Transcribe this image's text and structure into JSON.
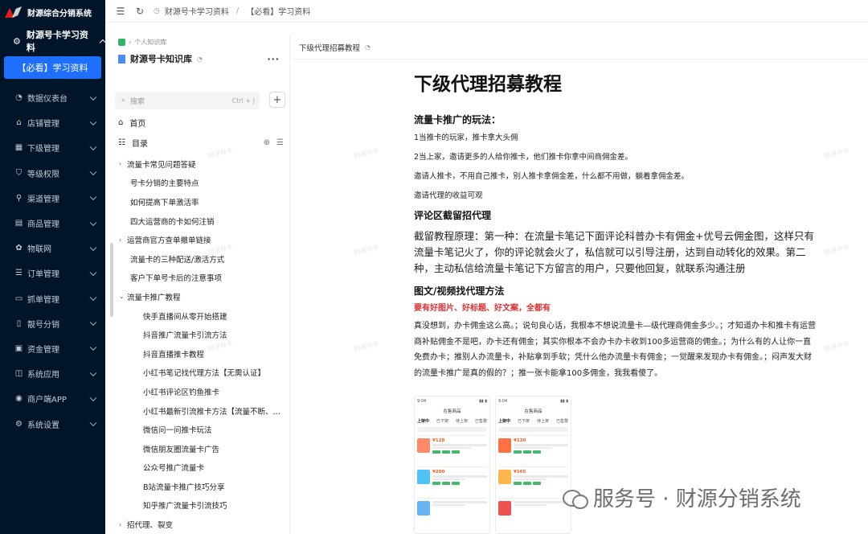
{
  "brand": {
    "title": "财源综合分销系统"
  },
  "header": {
    "breadcrumb": [
      "财源号卡学习资料",
      "【必看】学习资料"
    ]
  },
  "nav": {
    "group_title": "财源号卡学习资料",
    "active_item": "【必看】学习资料",
    "items": [
      {
        "label": "数据仪表台",
        "icon": "dashboard-icon"
      },
      {
        "label": "店铺管理",
        "icon": "shop-icon"
      },
      {
        "label": "下级管理",
        "icon": "grid-icon"
      },
      {
        "label": "等级权限",
        "icon": "shield-icon"
      },
      {
        "label": "渠道管理",
        "icon": "channel-icon"
      },
      {
        "label": "商品管理",
        "icon": "goods-icon"
      },
      {
        "label": "物联网",
        "icon": "iot-icon"
      },
      {
        "label": "订单管理",
        "icon": "order-icon"
      },
      {
        "label": "抓单管理",
        "icon": "catch-order-icon"
      },
      {
        "label": "靓号分销",
        "icon": "phone-icon"
      },
      {
        "label": "资金管理",
        "icon": "fund-icon"
      },
      {
        "label": "系统应用",
        "icon": "app-icon"
      },
      {
        "label": "商户端APP",
        "icon": "merchant-app-icon"
      },
      {
        "label": "系统设置",
        "icon": "gear-icon"
      }
    ]
  },
  "kb": {
    "path": "个人知识库",
    "title": "财源号卡知识库",
    "more": "···",
    "search_placeholder": "搜索",
    "search_shortcut": "Ctrl + J",
    "home": "首页",
    "toc": "目录",
    "tree": [
      {
        "label": "流量卡常见问题答疑",
        "level": 0,
        "caret": "›"
      },
      {
        "label": "号卡分销的主要特点",
        "level": 1
      },
      {
        "label": "如何提高下单激活率",
        "level": 1
      },
      {
        "label": "四大运营商的卡如何注销",
        "level": 1
      },
      {
        "label": "运营商官方查单撤单链接",
        "level": 0,
        "caret": "›"
      },
      {
        "label": "流量卡的三种配送/激活方式",
        "level": 1
      },
      {
        "label": "客户下单号卡后的注意事项",
        "level": 1
      },
      {
        "label": "流量卡推广教程",
        "level": 0,
        "caret": "⌄"
      },
      {
        "label": "快手直播间从零开始搭建",
        "level": 2
      },
      {
        "label": "抖音推广流量卡引流方法",
        "level": 2
      },
      {
        "label": "抖音直播推卡教程",
        "level": 2
      },
      {
        "label": "小红书笔记找代理方法【无需认证】",
        "level": 2
      },
      {
        "label": "小红书评论区钓鱼推卡",
        "level": 2
      },
      {
        "label": "小红书最新引流推卡方法【流量不断、…",
        "level": 2
      },
      {
        "label": "微信问一问推卡玩法",
        "level": 2
      },
      {
        "label": "微信朋友圈流量卡广告",
        "level": 2
      },
      {
        "label": "公众号推广流量卡",
        "level": 2
      },
      {
        "label": "B站流量卡推广技巧分享",
        "level": 2
      },
      {
        "label": "知乎推广流量卡引流技巧",
        "level": 2
      },
      {
        "label": "招代理、裂变",
        "level": 0,
        "caret": "›"
      }
    ]
  },
  "doc": {
    "head": "下级代理招募教程",
    "title": "下级代理招募教程",
    "s1_title": "流量卡推广的玩法：",
    "s1_p1": "1当推卡的玩家，推卡拿大头佣",
    "s1_p2": "2当上家，邀请更多的人给你推卡，他们推卡你拿中间商佣金差。",
    "s1_p3": "邀请人推卡，不用自己推卡，别人推卡拿佣金差，什么都不用做，躺着拿佣金差。",
    "s1_p4": "邀请代理的收益可观",
    "s2_title": "评论区截留招代理",
    "s2_body": "截留教程原理：第一种：在流量卡笔记下面评论科普办卡有佣金+优号云佣金图，这样只有流量卡笔记火了，你的评论就会火了，私信就可以引导注册，达到自动转化的效果。第二种，主动私信给流量卡笔记下方留言的用户，只要他回复，就联系沟通注册",
    "s3_title": "图文/视频找代理方法",
    "s3_red": "要有好图片、好标题、好文案，全都有",
    "s3_body": "真没想到，办卡佣金这么高。；说句良心话，我根本不想说流量卡—级代理商佣金多少。；才知道办卡和推卡有运营商补贴佣金不是吧，办卡还有佣金；其实你根本不会办卡办卡收到100多运营商的佣金。；为什么有的人让你一直免费办卡；推别人办流量卡，补贴拿到手软；凭什么他办流量卡有佣金；一觉醒来发现办卡有佣金。；闷声发大财的流量卡推广是真的假的？；推一张卡能拿100多佣金，我我看傻了。",
    "phone1": {
      "title": "在售商品",
      "tabs": [
        "上架中",
        "已下架",
        "待上架",
        "已售罄"
      ],
      "prices": [
        "¥128",
        "¥200"
      ]
    },
    "phone2": {
      "title": "在售商品",
      "tabs": [
        "上架中",
        "已下架",
        "待上架",
        "已售罄"
      ],
      "prices": [
        "¥130",
        "¥165"
      ]
    }
  },
  "watermark": "服务号 · 财源分销系统",
  "faint_mark": "财源号卡",
  "colors": {
    "nav_bg": "#001529",
    "accent": "#1e6fff",
    "red": "#e03131"
  }
}
